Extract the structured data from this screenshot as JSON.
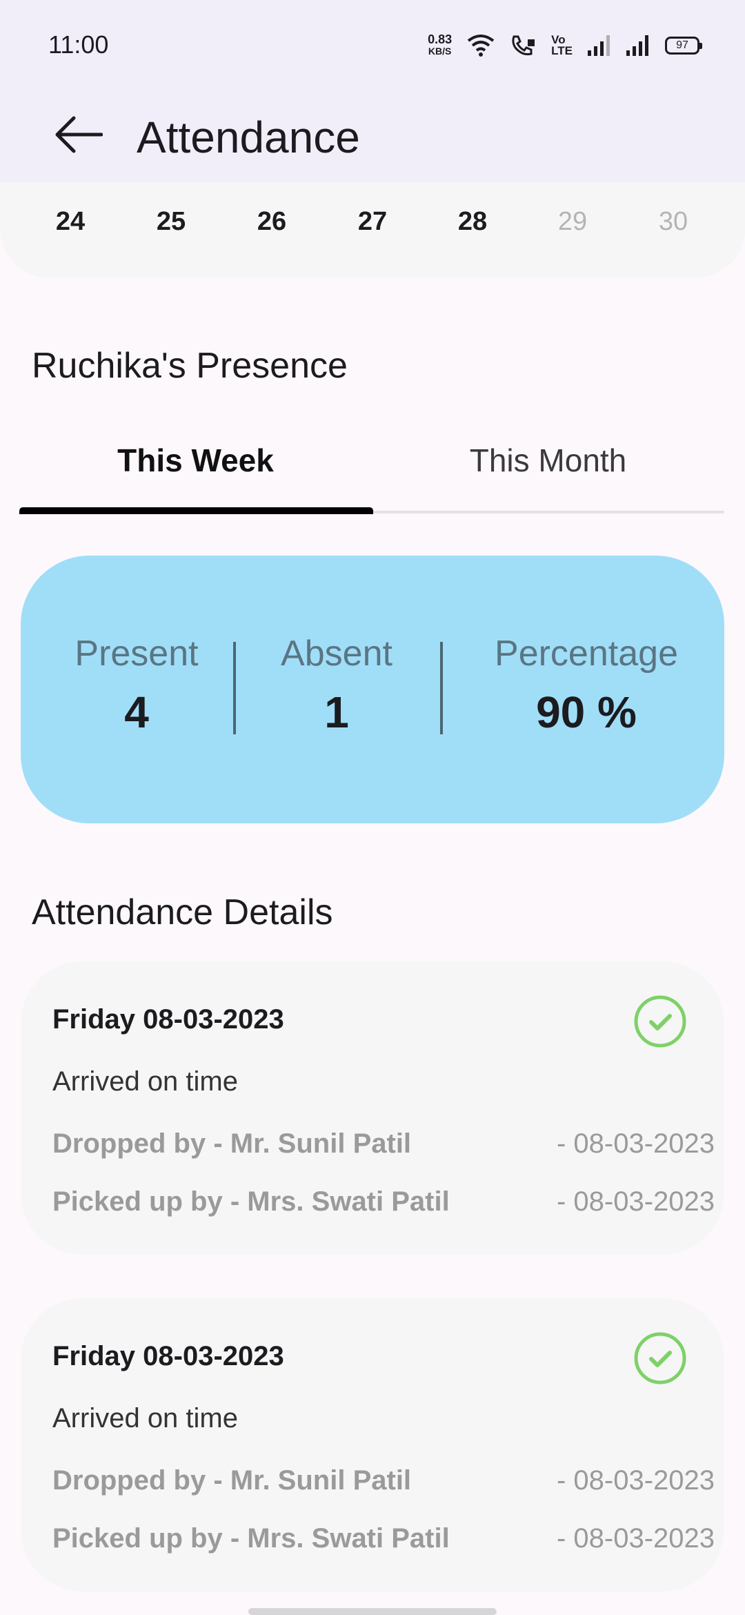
{
  "status_bar": {
    "time": "11:00",
    "net_speed_value": "0.83",
    "net_speed_unit": "KB/S",
    "volte_top": "Vo",
    "volte_bottom": "LTE",
    "battery": "97"
  },
  "app_bar": {
    "title": "Attendance",
    "back_icon": "arrow-left-icon"
  },
  "calendar": {
    "days": [
      {
        "label": "24",
        "enabled": true
      },
      {
        "label": "25",
        "enabled": true
      },
      {
        "label": "26",
        "enabled": true
      },
      {
        "label": "27",
        "enabled": true
      },
      {
        "label": "28",
        "enabled": true
      },
      {
        "label": "29",
        "enabled": false
      },
      {
        "label": "30",
        "enabled": false
      }
    ]
  },
  "presence": {
    "title": "Ruchika's Presence",
    "tabs": [
      {
        "label": "This Week",
        "active": true
      },
      {
        "label": "This Month",
        "active": false
      }
    ]
  },
  "summary": {
    "present_label": "Present",
    "present_value": "4",
    "absent_label": "Absent",
    "absent_value": "1",
    "percentage_label": "Percentage",
    "percentage_value": "90 %",
    "card_color": "#a0def8"
  },
  "details": {
    "title": "Attendance Details",
    "items": [
      {
        "date": "Friday 08-03-2023",
        "status": "Arrived on time",
        "dropped_by": "Dropped by - Mr. Sunil Patil",
        "dropped_date": "- 08-03-2023",
        "picked_by": "Picked up by - Mrs. Swati Patil",
        "picked_date": "- 08-03-2023",
        "icon": "check-circle-icon"
      },
      {
        "date": "Friday 08-03-2023",
        "status": "Arrived on time",
        "dropped_by": "Dropped by - Mr. Sunil Patil",
        "dropped_date": "- 08-03-2023",
        "picked_by": "Picked up by - Mrs. Swati Patil",
        "picked_date": "- 08-03-2023",
        "icon": "check-circle-icon"
      }
    ],
    "check_color": "#7ed168"
  }
}
